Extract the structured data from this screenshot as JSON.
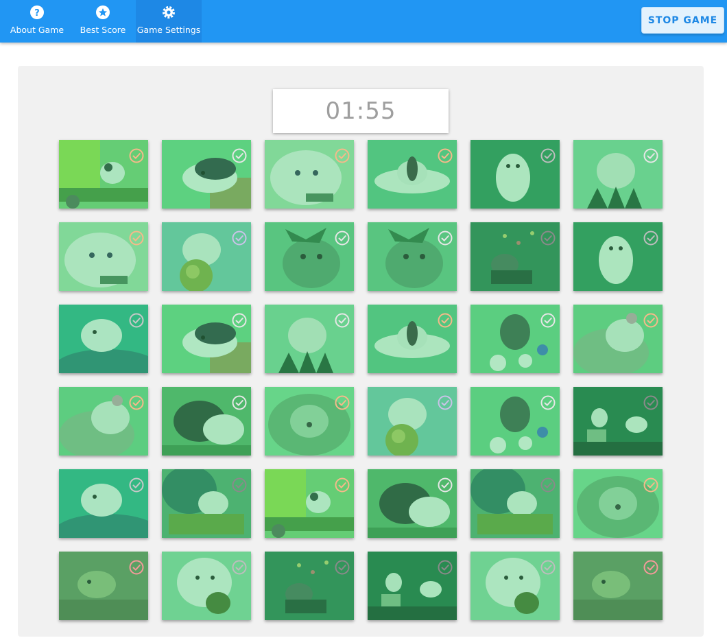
{
  "nav": {
    "about_label": "About Game",
    "best_label": "Best Score",
    "settings_label": "Game Settings"
  },
  "stop_button_label": "STOP GAME",
  "timer": "01:55",
  "colors": {
    "appbar": "#2196f3",
    "tint": "#3cc86e"
  },
  "cards": [
    {
      "scene": "truck",
      "check": "#f6b98a"
    },
    {
      "scene": "hooded",
      "check": "#e6e6e6"
    },
    {
      "scene": "closeup",
      "check": "#f6b98a"
    },
    {
      "scene": "cup",
      "check": "#f6b98a"
    },
    {
      "scene": "standing",
      "check": "#bdbdbd"
    },
    {
      "scene": "grass",
      "check": "#e6e6e6"
    },
    {
      "scene": "closeup",
      "check": "#f6b98a"
    },
    {
      "scene": "apple",
      "check": "#c9c3e8"
    },
    {
      "scene": "tree",
      "check": "#e6e6e6"
    },
    {
      "scene": "tree",
      "check": "#e6e6e6"
    },
    {
      "scene": "dark",
      "check": "#8a8a8a"
    },
    {
      "scene": "standing",
      "check": "#bdbdbd"
    },
    {
      "scene": "hand",
      "check": "#c8c8c8"
    },
    {
      "scene": "hooded",
      "check": "#e6e6e6"
    },
    {
      "scene": "grass",
      "check": "#e6e6e6"
    },
    {
      "scene": "cup",
      "check": "#f6b98a"
    },
    {
      "scene": "flowers",
      "check": "#e6e6e6"
    },
    {
      "scene": "palm",
      "check": "#f6b98a"
    },
    {
      "scene": "palm",
      "check": "#f6b98a"
    },
    {
      "scene": "blackrat",
      "check": "#e6e6e6"
    },
    {
      "scene": "hammock",
      "check": "#f6b98a"
    },
    {
      "scene": "apple",
      "check": "#c9c3e8"
    },
    {
      "scene": "flowers",
      "check": "#e6e6e6"
    },
    {
      "scene": "duo",
      "check": "#8a8a8a"
    },
    {
      "scene": "hand",
      "check": "#c8c8c8"
    },
    {
      "scene": "basket",
      "check": "#8a8a8a"
    },
    {
      "scene": "truck",
      "check": "#f6b98a"
    },
    {
      "scene": "blackrat",
      "check": "#e6e6e6"
    },
    {
      "scene": "basket",
      "check": "#8a8a8a"
    },
    {
      "scene": "hammock",
      "check": "#f6b98a"
    },
    {
      "scene": "brown",
      "check": "#f49a9a"
    },
    {
      "scene": "turtle",
      "check": "#bdbdbd"
    },
    {
      "scene": "dark",
      "check": "#8a8a8a"
    },
    {
      "scene": "duo",
      "check": "#8a8a8a"
    },
    {
      "scene": "turtle",
      "check": "#bdbdbd"
    },
    {
      "scene": "brown",
      "check": "#f49a9a"
    }
  ]
}
